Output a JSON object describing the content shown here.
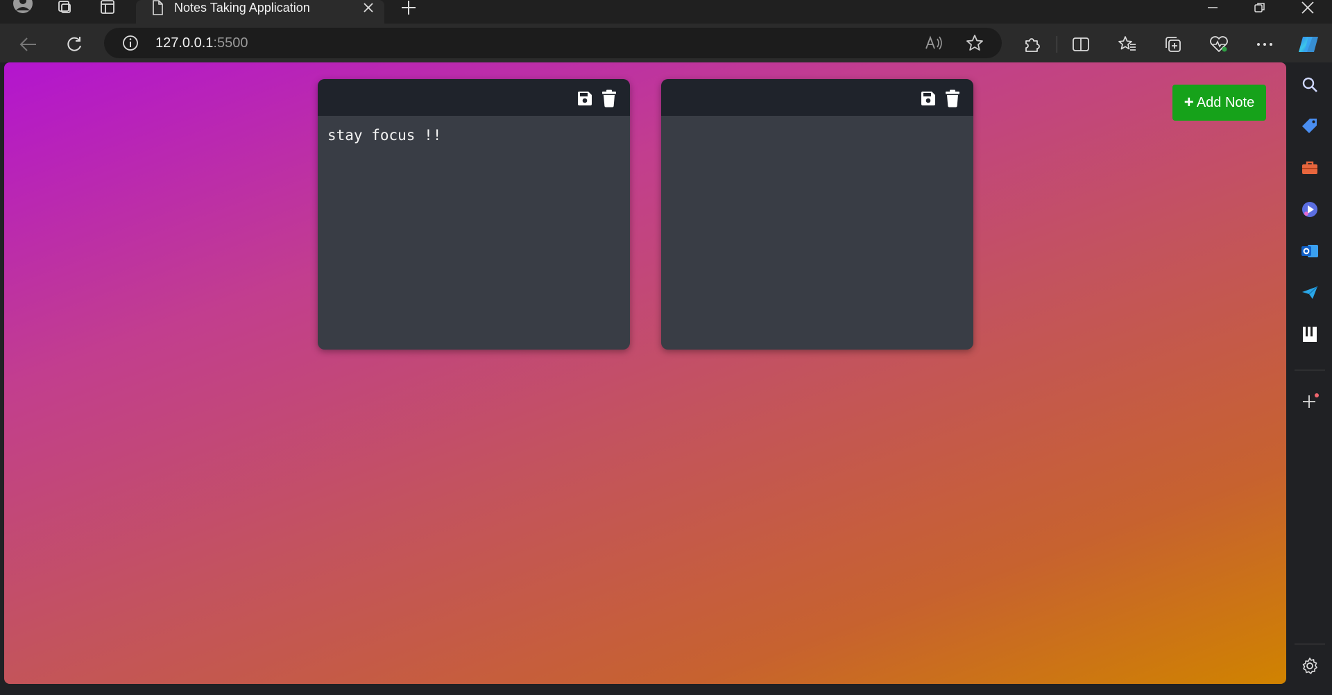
{
  "browser": {
    "tab_title": "Notes Taking Application",
    "url_host": "127.0.0.1",
    "url_port": ":5500",
    "icons": {
      "profile": "profile-avatar-icon",
      "workspaces": "workspaces-icon",
      "tab_actions": "vertical-tabs-icon",
      "page": "page-icon",
      "close_tab": "close-icon",
      "new_tab": "plus-icon",
      "minimize": "minimize-icon",
      "restore": "restore-icon",
      "close_window": "close-icon",
      "back": "back-arrow-icon",
      "refresh": "refresh-icon",
      "site_info": "info-icon",
      "read_aloud": "read-aloud-icon",
      "favorite": "star-icon",
      "extensions": "puzzle-icon",
      "split_screen": "split-screen-icon",
      "favorites": "favorites-icon",
      "collections": "collections-icon",
      "health": "browser-essentials-icon",
      "more": "more-icon",
      "copilot": "copilot-icon"
    }
  },
  "sidebar": {
    "items": [
      {
        "name": "search-icon",
        "color": "#8ab4f8"
      },
      {
        "name": "shopping-tag-icon",
        "color": "#4a90e2"
      },
      {
        "name": "tools-icon",
        "color": "#e8663d"
      },
      {
        "name": "games-icon",
        "color": "#5b6ee1"
      },
      {
        "name": "outlook-icon",
        "color": "#1a73e8"
      },
      {
        "name": "send-icon",
        "color": "#2aa7e8"
      },
      {
        "name": "document-icon",
        "color": "#ffffff"
      }
    ],
    "add_icon": "plus-icon",
    "settings_icon": "gear-icon"
  },
  "app": {
    "add_note_label": "Add Note",
    "add_note_color": "#16a21a",
    "notes": [
      {
        "text": "stay focus !!",
        "save_icon": "floppy-disk-icon",
        "delete_icon": "trash-icon"
      },
      {
        "text": "",
        "save_icon": "floppy-disk-icon",
        "delete_icon": "trash-icon"
      }
    ]
  }
}
